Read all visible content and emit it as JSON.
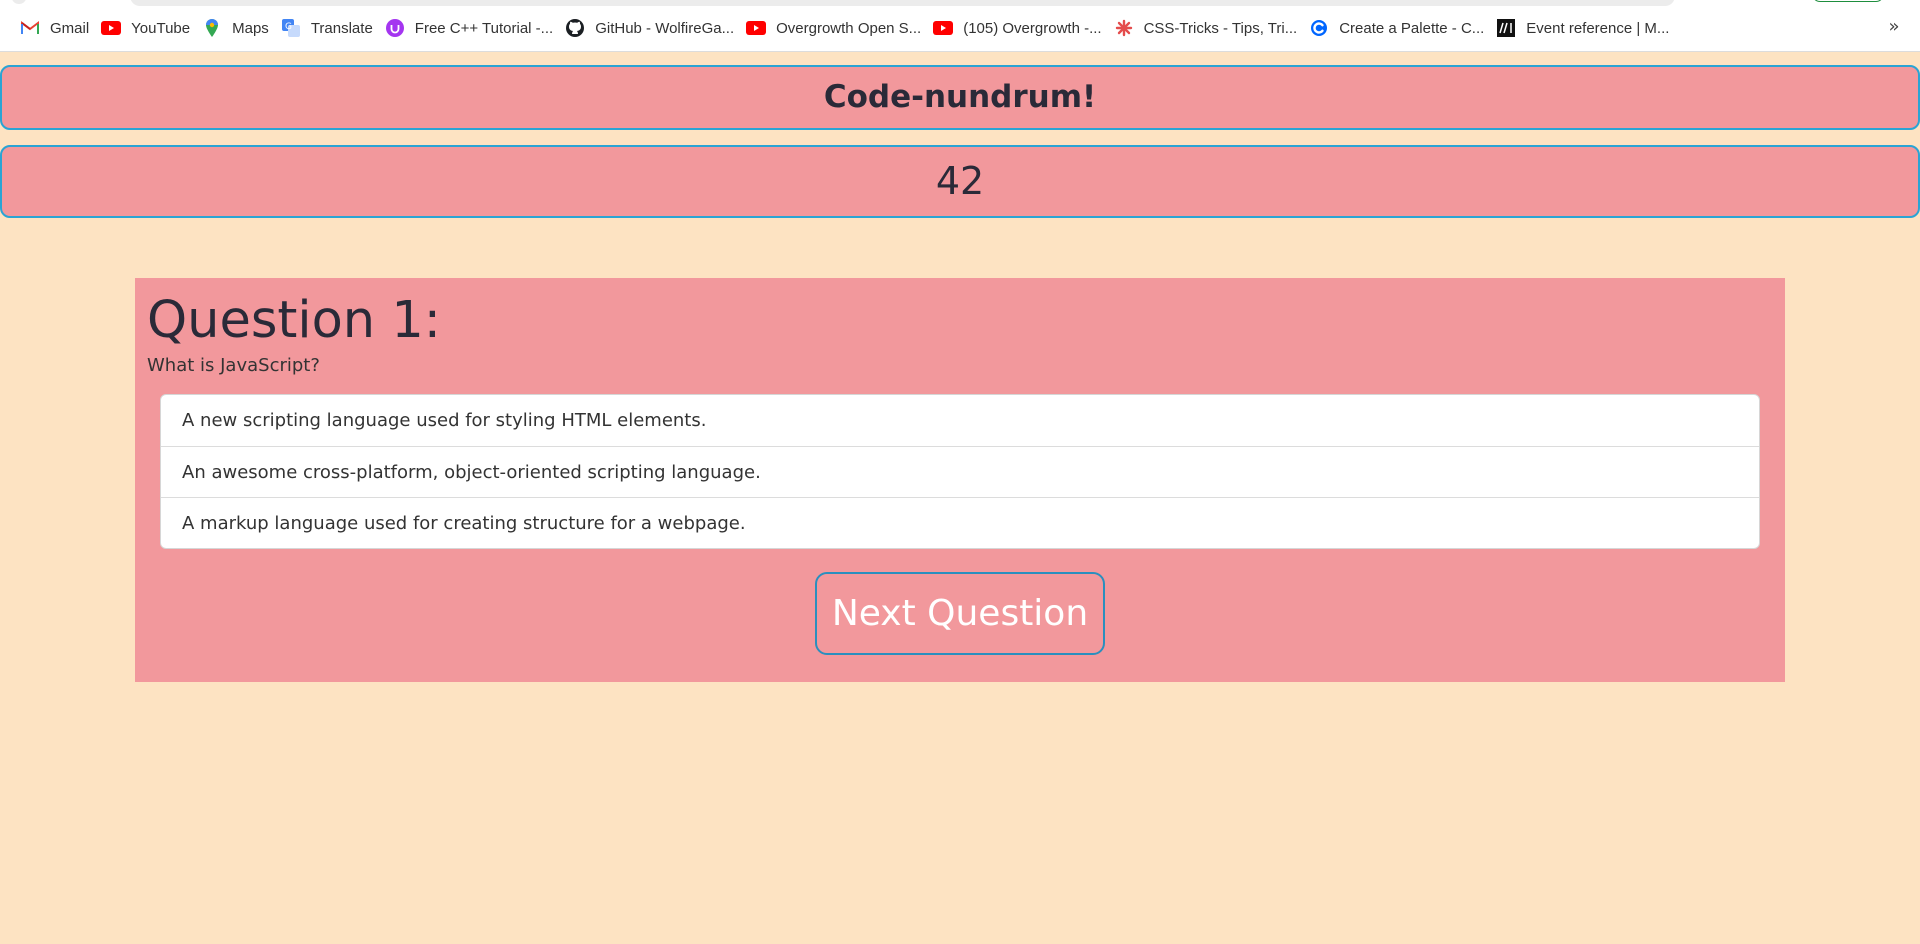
{
  "bookmarks": [
    {
      "label": "Gmail",
      "icon": "gmail-icon"
    },
    {
      "label": "YouTube",
      "icon": "youtube-icon"
    },
    {
      "label": "Maps",
      "icon": "maps-icon"
    },
    {
      "label": "Translate",
      "icon": "translate-icon"
    },
    {
      "label": "Free C++ Tutorial -...",
      "icon": "udemy-icon"
    },
    {
      "label": "GitHub - WolfireGa...",
      "icon": "github-icon"
    },
    {
      "label": "Overgrowth Open S...",
      "icon": "youtube-icon"
    },
    {
      "label": "(105) Overgrowth -...",
      "icon": "youtube-icon"
    },
    {
      "label": "CSS-Tricks - Tips, Tri...",
      "icon": "css-tricks-icon"
    },
    {
      "label": "Create a Palette - C...",
      "icon": "coolors-icon"
    },
    {
      "label": "Event reference | M...",
      "icon": "mdn-icon"
    }
  ],
  "bookmarks_overflow": "»",
  "app": {
    "title": "Code-nundrum!",
    "score": "42"
  },
  "quiz": {
    "heading": "Question 1:",
    "question": "What is JavaScript?",
    "answers": [
      "A new scripting language used for styling HTML elements.",
      "An awesome cross-platform, object-oriented scripting language.",
      "A markup language used for creating structure for a webpage."
    ],
    "next_label": "Next Question"
  },
  "colors": {
    "page_background": "#fde3c2",
    "panel_pink": "#f2989c",
    "border_blue": "#2aa4d4",
    "heading_text": "#2a2a38"
  }
}
